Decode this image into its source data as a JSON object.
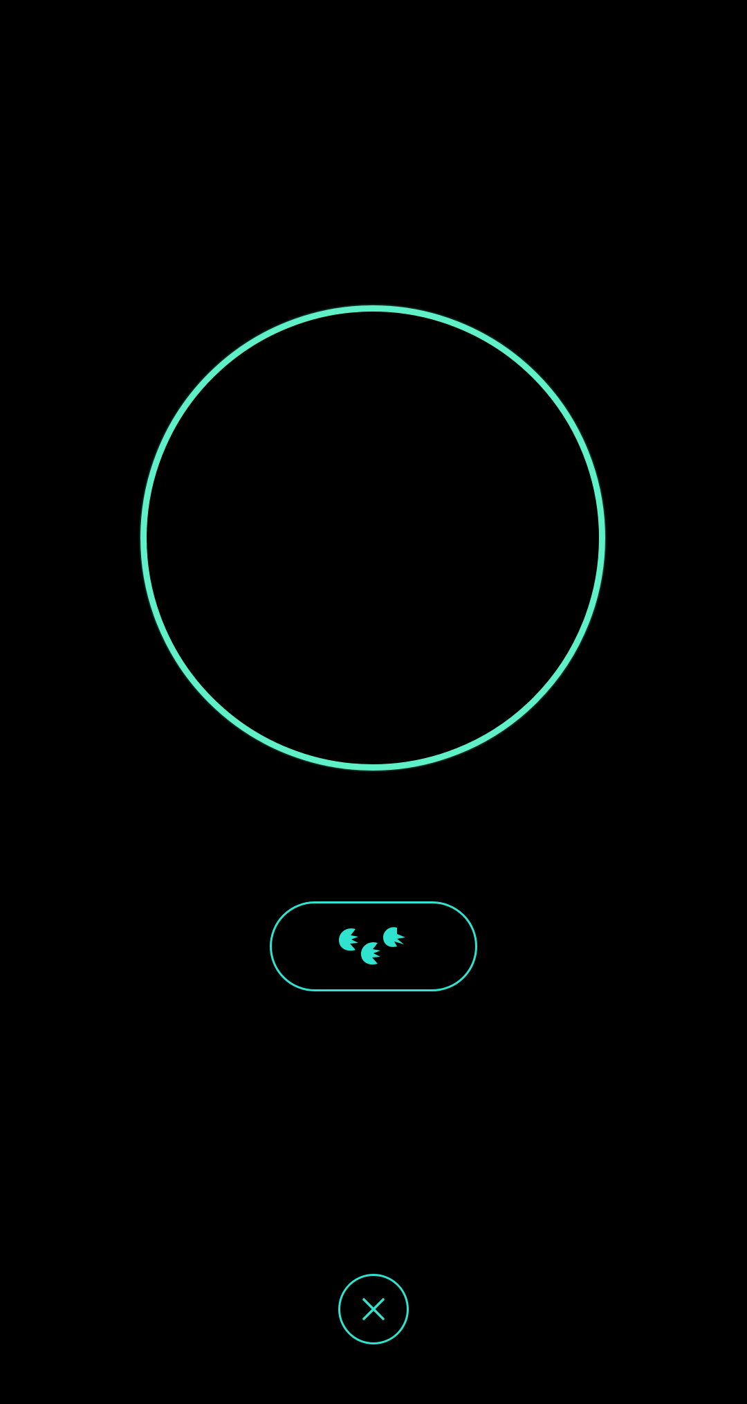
{
  "screen": {
    "background_color": "#000000"
  },
  "capture_ring": {
    "color": "#5ff0c8"
  },
  "tracks_button": {
    "icon": "footprints-icon",
    "color": "#2fe3cf"
  },
  "close_button": {
    "icon": "close-icon",
    "color": "#2fe3cf"
  }
}
